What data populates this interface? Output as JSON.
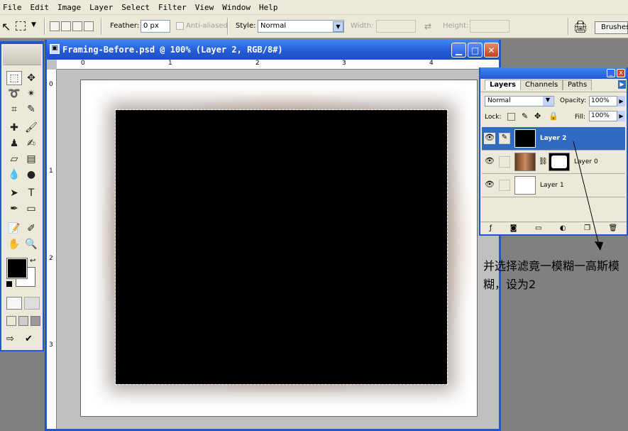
{
  "menu": [
    "File",
    "Edit",
    "Image",
    "Layer",
    "Select",
    "Filter",
    "View",
    "Window",
    "Help"
  ],
  "options": {
    "feather_label": "Feather:",
    "feather_value": "0 px",
    "anti_aliased_label": "Anti-aliased",
    "style_label": "Style:",
    "style_value": "Normal",
    "width_label": "Width:",
    "height_label": "Height:",
    "brushes_label": "Brushes"
  },
  "document": {
    "title": "Framing-Before.psd @ 100% (Layer 2, RGB/8#)",
    "ruler_h": [
      "0",
      "1",
      "2",
      "3",
      "4"
    ],
    "ruler_v": [
      "0",
      "1",
      "2",
      "3"
    ]
  },
  "layers_panel": {
    "tabs": [
      "Layers",
      "Channels",
      "Paths"
    ],
    "blend_mode": "Normal",
    "opacity_label": "Opacity:",
    "opacity_value": "100%",
    "lock_label": "Lock:",
    "fill_label": "Fill:",
    "fill_value": "100%",
    "layers": [
      {
        "name": "Layer 2",
        "selected": true
      },
      {
        "name": "Layer 0",
        "selected": false
      },
      {
        "name": "Layer 1",
        "selected": false
      }
    ]
  },
  "annotation": "并选择滤竟一模糊一高斯模糊，设为2",
  "colors": {
    "titlebar": "#2456c9",
    "selection": "#316ac5",
    "chrome": "#ece9d8"
  }
}
